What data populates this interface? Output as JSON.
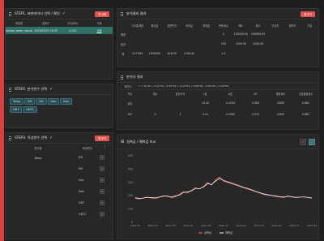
{
  "panel1": {
    "title": "STEP1. 표본데이터 선택 / 확인",
    "delete_label": "행 삭제",
    "columns": [
      "파일명",
      "업로드",
      "크기(KB)",
      "삭제"
    ],
    "row": [
      "Jaehba_water_stocks",
      "2023/05/03 16:35",
      "4,123",
      "삭제"
    ]
  },
  "panel2": {
    "title": "STEP2. 분석변수 선택",
    "tags": [
      "Temp",
      "DO",
      "NO",
      "Uav",
      "Sals",
      "ODT",
      "ODT1"
    ]
  },
  "panel3": {
    "title": "STEP3. 독성변수 선택",
    "button_label": "행 추가",
    "columns": [
      "변수명",
      "독성변수"
    ],
    "left_value": "Temp",
    "items": [
      "DO",
      "NO",
      "Uav",
      "Sals",
      "ODT",
      "ODT1"
    ]
  },
  "panel4": {
    "title": "분석결과 결과",
    "button_label": "행 추가",
    "columns": [
      "",
      "기초통계량",
      "평균값",
      "표준편차",
      "최솟값",
      "최댓값",
      "변동계수",
      "왜도",
      "첨도",
      "이상치",
      "결측치",
      "구분"
    ],
    "rows": [
      [
        "평균",
        "",
        "",
        "",
        "",
        "",
        "4",
        "100000.00",
        "100000.00",
        "",
        "",
        ""
      ],
      [
        "분산",
        "",
        "",
        "",
        "",
        "",
        "100",
        "1000.00",
        "1000.00",
        "",
        "",
        ""
      ],
      [
        "최",
        "127.934",
        "1039400",
        "104270",
        "1100.00",
        "",
        "1.0",
        "",
        "",
        "",
        "",
        ""
      ]
    ]
  },
  "panel5": {
    "title": "분석식 결과",
    "formula_label": "회귀식",
    "formula": "Y = 10.45 + 0.21*X1 - 0.35*X2 + 0.12*X3 + 0.08*X4 - 0.04*X5 + 0.02*X6",
    "columns": [
      "변수",
      "계수",
      "표준오차",
      "t값",
      "p값",
      "VIF",
      "결정계수",
      "수정결정계수"
    ],
    "rows": [
      [
        "상수",
        "",
        "",
        "10.45",
        "0.1234",
        "0.000",
        "0.853",
        "0.861"
      ],
      [
        "DO",
        "0",
        "1",
        "0.21",
        "0.2345",
        "0.012",
        "0.853",
        "0.861"
      ]
    ]
  },
  "chart": {
    "title": "실측값 / 예측값 비교",
    "legend": [
      "실측값",
      "예측값"
    ],
    "colors": {
      "observed": "#ff6b6b",
      "predicted": "#ffffff"
    },
    "chart_data": {
      "type": "line",
      "y_ticks": [
        "500",
        "400",
        "300",
        "200",
        "100",
        "0"
      ],
      "ylim": [
        0,
        500
      ],
      "x_ticks": [
        "2021.01",
        "2021.03",
        "2021.05",
        "2021.07",
        "2021.09",
        "2021.11",
        "2022.01",
        "2022.03",
        "2022.05",
        "2022.07",
        "2022.09"
      ],
      "series": [
        {
          "name": "실측값",
          "values": [
            180,
            175,
            185,
            190,
            182,
            178,
            188,
            195,
            200,
            185,
            192,
            210,
            230,
            220,
            240,
            260,
            250,
            270,
            300,
            280,
            320,
            340,
            310,
            300,
            290,
            280,
            270,
            260,
            250,
            240,
            230,
            220,
            210,
            205,
            200,
            195,
            190,
            185,
            200,
            190,
            185,
            188,
            192,
            186,
            180
          ]
        },
        {
          "name": "예측값",
          "values": [
            185,
            180,
            182,
            188,
            186,
            184,
            190,
            198,
            196,
            190,
            198,
            205,
            225,
            228,
            238,
            255,
            252,
            265,
            290,
            285,
            310,
            330,
            315,
            305,
            295,
            285,
            275,
            262,
            255,
            245,
            232,
            224,
            214,
            208,
            202,
            198,
            192,
            190,
            196,
            192,
            188,
            190,
            190,
            188,
            184
          ]
        }
      ]
    }
  }
}
